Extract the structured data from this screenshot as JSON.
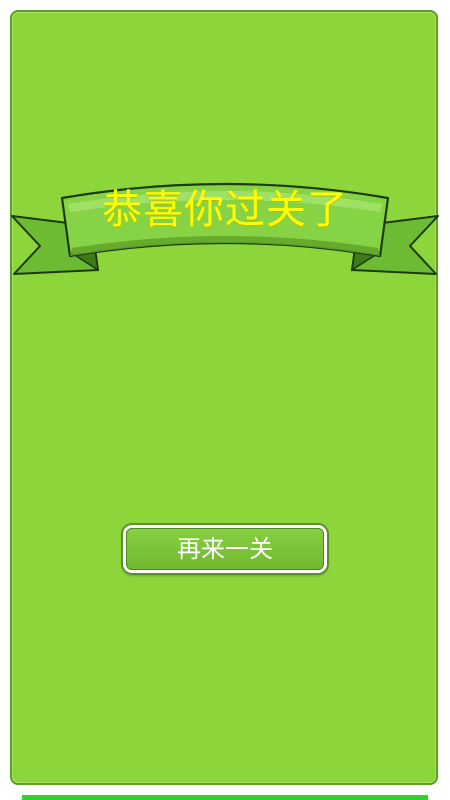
{
  "level_complete": {
    "banner_title": "恭喜你过关了",
    "play_again_label": "再来一关"
  },
  "colors": {
    "background_green": "#8cd63c",
    "ribbon_green": "#7bc83c",
    "ribbon_dark": "#5fa529",
    "title_yellow": "#ffff00",
    "button_text": "#ffffff"
  },
  "icons": {
    "banner": "ribbon-banner"
  }
}
